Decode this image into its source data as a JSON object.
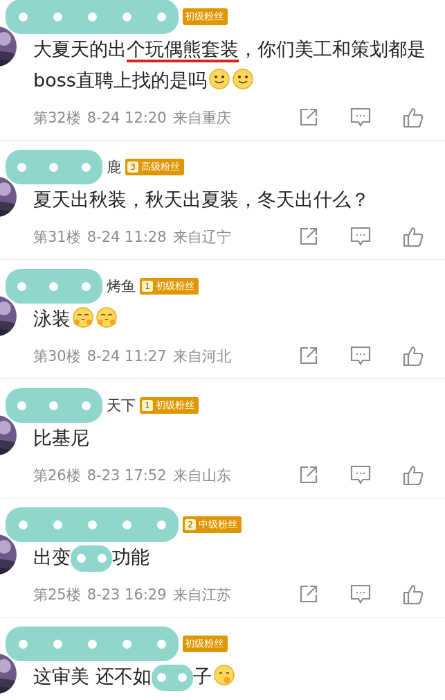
{
  "comments": [
    {
      "name_redacted": true,
      "badge": {
        "label": "初级粉丝"
      },
      "content": [
        {
          "kind": "text",
          "text": "大夏天的出"
        },
        {
          "kind": "underlined",
          "text": "个玩偶熊套装"
        },
        {
          "kind": "text",
          "text": "，你们美工和策划都是boss直聘上找的是吗"
        },
        {
          "kind": "smile"
        },
        {
          "kind": "smile"
        }
      ],
      "meta": {
        "floor": "第32楼",
        "time": "8-24 12:20",
        "location": "来自重庆"
      }
    },
    {
      "name_redacted": true,
      "name": "鹿",
      "badge": {
        "level": "3",
        "label": "高级粉丝"
      },
      "content": [
        {
          "kind": "text",
          "text": "夏天出秋装，秋天出夏装，冬天出什么？"
        }
      ],
      "meta": {
        "floor": "第31楼",
        "time": "8-24 11:28",
        "location": "来自辽宁"
      }
    },
    {
      "name_redacted": true,
      "name": "烤鱼",
      "badge": {
        "level": "1",
        "label": "初级粉丝"
      },
      "content": [
        {
          "kind": "text",
          "text": "泳装"
        },
        {
          "kind": "hug"
        },
        {
          "kind": "hug"
        }
      ],
      "meta": {
        "floor": "第30楼",
        "time": "8-24 11:27",
        "location": "来自河北"
      }
    },
    {
      "name_redacted": true,
      "name": "天下",
      "badge": {
        "level": "1",
        "label": "初级粉丝"
      },
      "content": [
        {
          "kind": "text",
          "text": "比基尼"
        }
      ],
      "meta": {
        "floor": "第26楼",
        "time": "8-23 17:52",
        "location": "来自山东"
      }
    },
    {
      "name_redacted": true,
      "badge": {
        "level": "2",
        "label": "中级粉丝"
      },
      "content": [
        {
          "kind": "text",
          "text": "出变"
        },
        {
          "kind": "redacted"
        },
        {
          "kind": "text",
          "text": "功能"
        }
      ],
      "meta": {
        "floor": "第25楼",
        "time": "8-23 16:29",
        "location": "来自江苏"
      }
    },
    {
      "name_redacted": true,
      "badge": {
        "label": "初级粉丝"
      },
      "content": [
        {
          "kind": "text",
          "text": "这审美 还不如"
        },
        {
          "kind": "redacted"
        },
        {
          "kind": "text",
          "text": "子"
        },
        {
          "kind": "shush"
        }
      ]
    }
  ]
}
